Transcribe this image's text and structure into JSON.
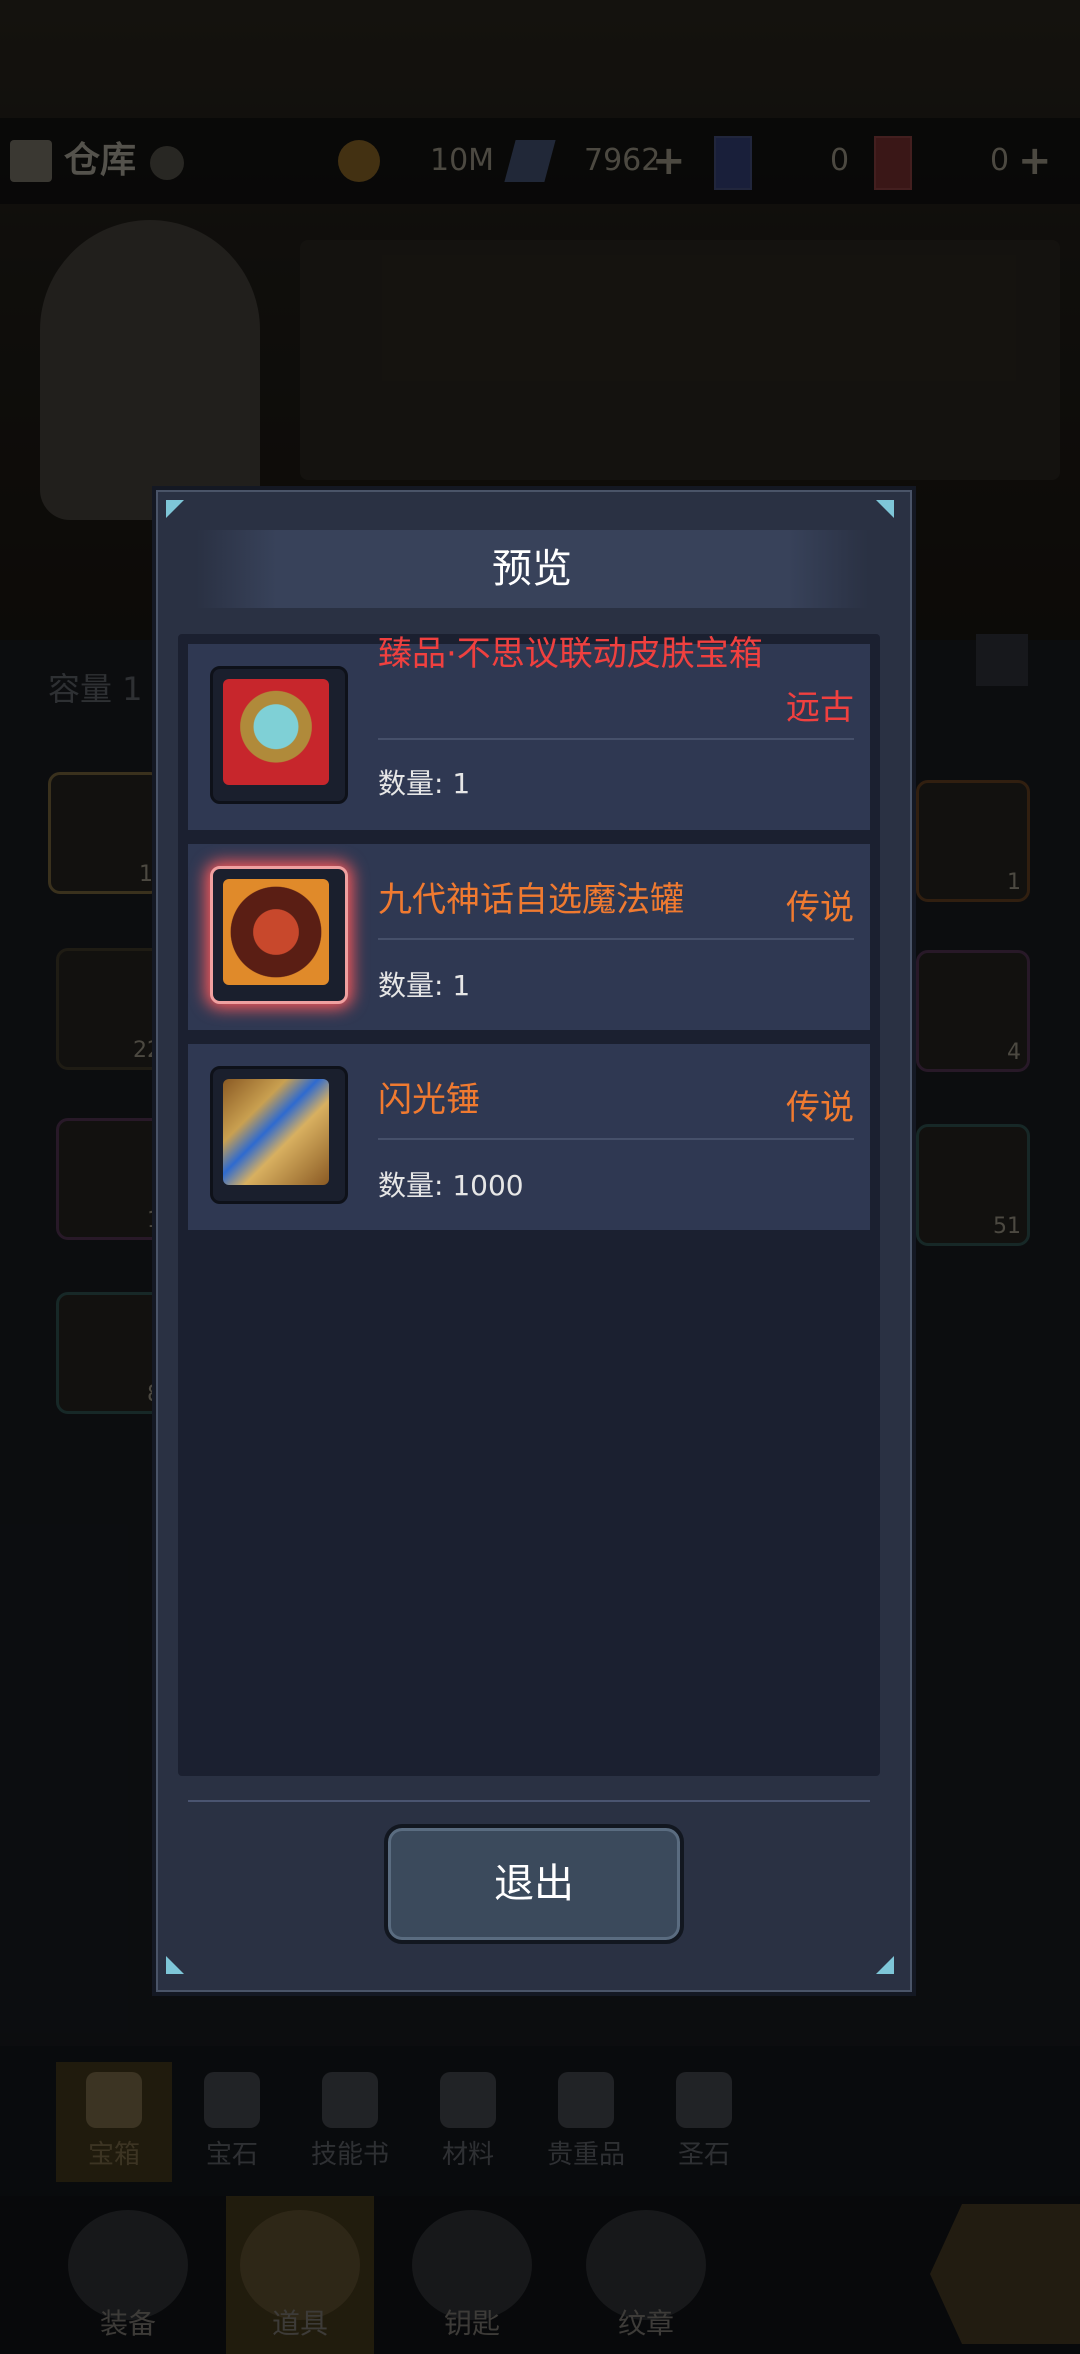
{
  "topbar": {
    "title": "仓库",
    "gold": "10M",
    "crystals": "7962",
    "ticket_blue": "0",
    "ticket_red": "0"
  },
  "background": {
    "capacity_label": "容量 1",
    "slots_left": [
      "1",
      "22",
      "1",
      "8"
    ],
    "slots_right": [
      "1",
      "4",
      "51"
    ]
  },
  "modal": {
    "title": "预览",
    "items": [
      {
        "name": "臻品·不思议联动皮肤宝箱",
        "rarity": "远古",
        "qty_label": "数量: 1",
        "name_color": "#f0403f",
        "rarity_color": "#f0403f"
      },
      {
        "name": "九代神话自选魔法罐",
        "rarity": "传说",
        "qty_label": "数量: 1",
        "name_color": "#f07a30",
        "rarity_color": "#f07a30"
      },
      {
        "name": "闪光锤",
        "rarity": "传说",
        "qty_label": "数量: 1000",
        "name_color": "#f07a30",
        "rarity_color": "#f07a30"
      }
    ],
    "exit_label": "退出"
  },
  "subtabs": [
    {
      "label": "宝箱",
      "icon": "chest-icon"
    },
    {
      "label": "宝石",
      "icon": "gem-icon"
    },
    {
      "label": "技能书",
      "icon": "book-icon"
    },
    {
      "label": "材料",
      "icon": "material-icon"
    },
    {
      "label": "贵重品",
      "icon": "valuable-icon"
    },
    {
      "label": "圣石",
      "icon": "holy-stone-icon"
    }
  ],
  "nav": [
    {
      "label": "装备",
      "icon": "equipment-icon"
    },
    {
      "label": "道具",
      "icon": "item-icon"
    },
    {
      "label": "钥匙",
      "icon": "key-icon"
    },
    {
      "label": "纹章",
      "icon": "emblem-icon"
    }
  ]
}
